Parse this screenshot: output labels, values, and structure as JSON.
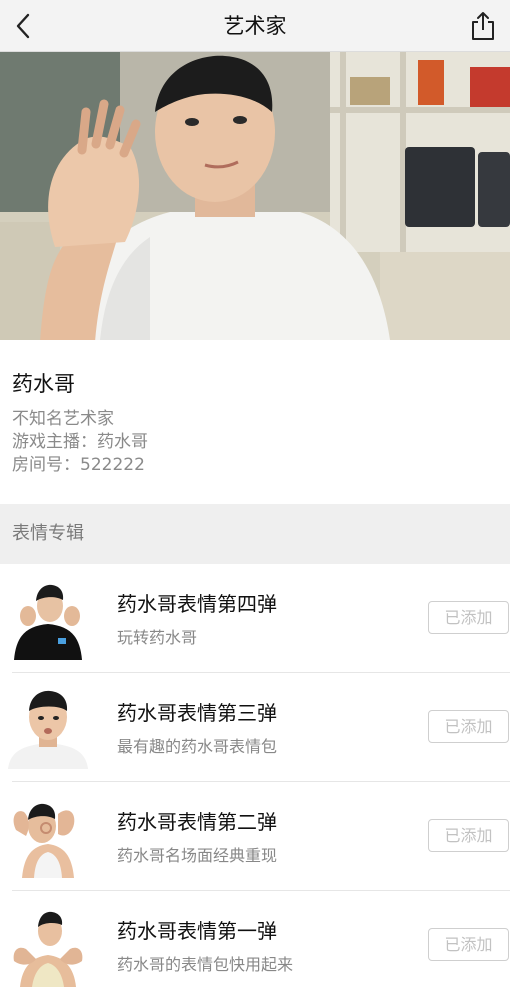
{
  "nav": {
    "title": "艺术家",
    "back_icon": "chevron-left-icon",
    "share_icon": "share-icon"
  },
  "hero": {
    "image_subject": "man in white t-shirt waving at camera"
  },
  "artist": {
    "name": "药水哥",
    "lines": [
      "不知名艺术家",
      "游戏主播：药水哥",
      "房间号：522222"
    ]
  },
  "section": {
    "title": "表情专辑"
  },
  "albums": [
    {
      "title": "药水哥表情第四弹",
      "subtitle": "玩转药水哥",
      "button": "已添加"
    },
    {
      "title": "药水哥表情第三弹",
      "subtitle": "最有趣的药水哥表情包",
      "button": "已添加"
    },
    {
      "title": "药水哥表情第二弹",
      "subtitle": "药水哥名场面经典重现",
      "button": "已添加"
    },
    {
      "title": "药水哥表情第一弹",
      "subtitle": "药水哥的表情包快用起来",
      "button": "已添加"
    }
  ]
}
